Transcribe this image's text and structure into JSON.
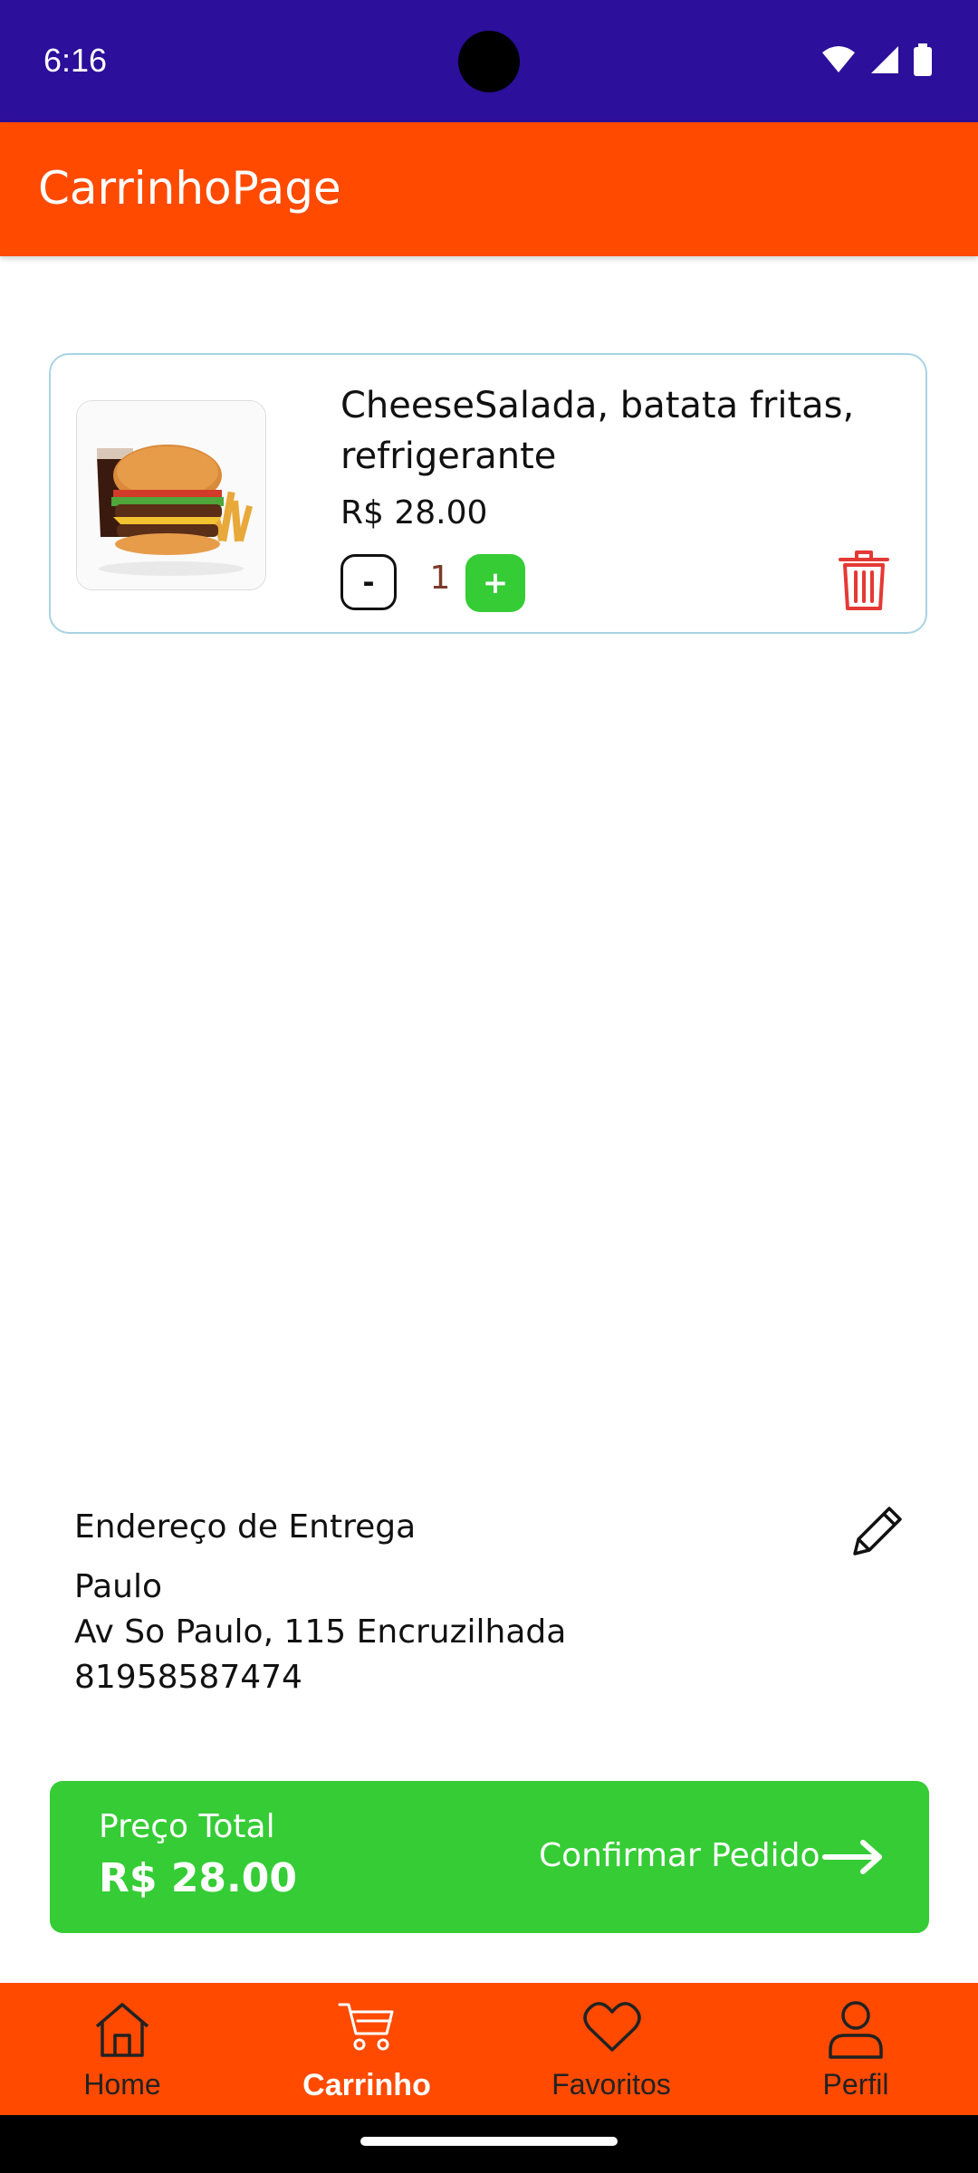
{
  "status_bar": {
    "time": "6:16"
  },
  "app_bar": {
    "title": "CarrinhoPage"
  },
  "cart": {
    "items": [
      {
        "name": "CheeseSalada, batata fritas, refrigerante",
        "price": "R$ 28.00",
        "quantity": "1",
        "minus_label": "-",
        "plus_label": "+"
      }
    ]
  },
  "address": {
    "title": "Endereço de Entrega",
    "name": "Paulo",
    "street": "Av So Paulo, 115 Encruzilhada",
    "phone": "81958587474"
  },
  "checkout": {
    "total_label": "Preço Total",
    "total_value": "R$ 28.00",
    "confirm_label": "Confirmar Pedido"
  },
  "bottom_nav": {
    "items": [
      {
        "label": "Home",
        "icon": "home-icon"
      },
      {
        "label": "Carrinho",
        "icon": "cart-icon",
        "active": true
      },
      {
        "label": "Favoritos",
        "icon": "heart-icon"
      },
      {
        "label": "Perfil",
        "icon": "person-icon"
      }
    ]
  },
  "colors": {
    "status_bar": "#2c0f9a",
    "primary": "#ff4a00",
    "accent_green": "#35cc35",
    "delete_red": "#e53935"
  }
}
